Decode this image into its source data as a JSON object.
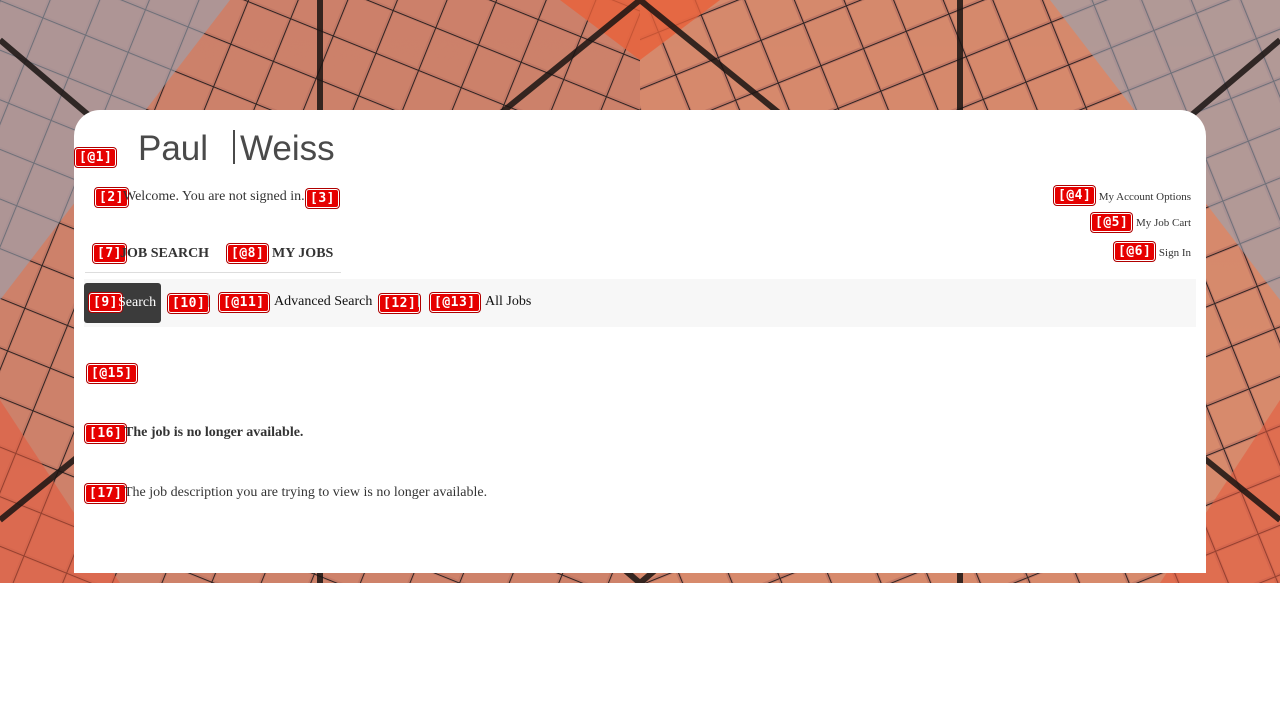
{
  "brand": {
    "logo_left": "Paul",
    "logo_right": "Weiss",
    "logo_color": "#4a4a4a"
  },
  "header": {
    "welcome_text": "Welcome. You are not signed in.",
    "my_account": "My Account Options",
    "job_cart": "My Job Cart",
    "sign_in": "Sign In"
  },
  "nav": {
    "job_search": "JOB SEARCH",
    "my_jobs": "MY JOBS"
  },
  "subnav": {
    "search": "Search",
    "advanced_search": "Advanced Search",
    "all_jobs": "All Jobs",
    "search_bg_color": "#3b3b3b"
  },
  "message": {
    "title": "The job is no longer available.",
    "body": "The job description you are trying to view is no longer available."
  },
  "markers": {
    "m1": "[@1]",
    "m2": "[2]",
    "m3": "[3]",
    "m4": "[@4]",
    "m5": "[@5]",
    "m6": "[@6]",
    "m7": "[7]",
    "m8": "[@8]",
    "m9": "[9]",
    "m10": "[10]",
    "m11": "[@11]",
    "m12": "[12]",
    "m13": "[@13]",
    "m15": "[@15]",
    "m16": "[16]",
    "m17": "[17]"
  },
  "colors": {
    "marker_red": "#e60000",
    "bg_orange": "#c0674f",
    "bg_mullion": "#1a1412"
  }
}
